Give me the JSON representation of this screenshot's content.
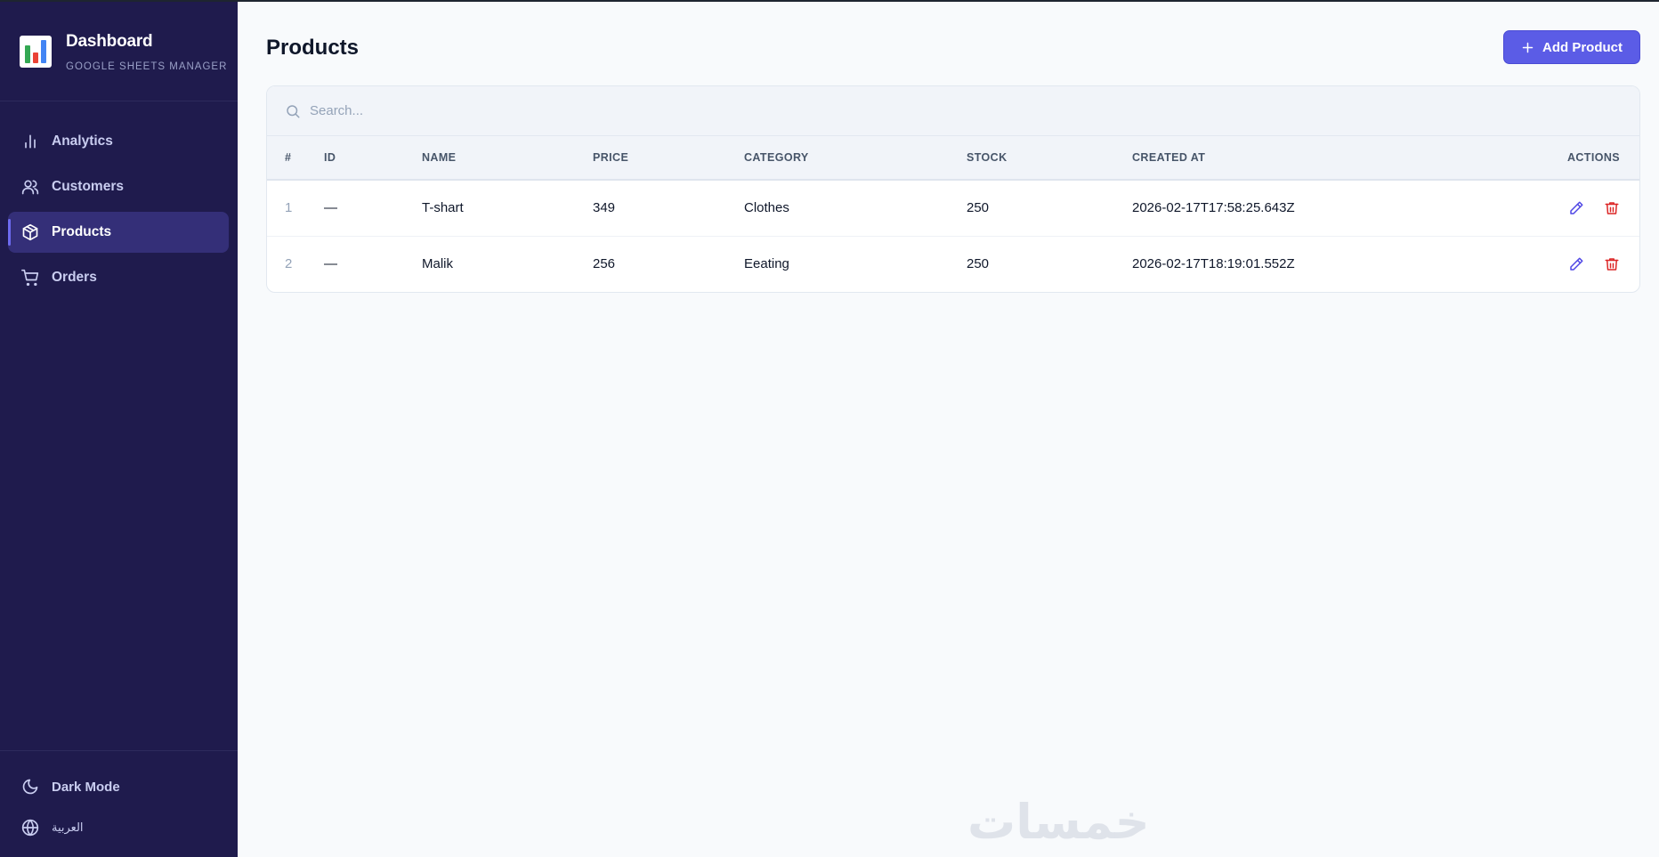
{
  "brand": {
    "title": "Dashboard",
    "subtitle": "GOOGLE SHEETS MANAGER"
  },
  "sidebar": {
    "items": [
      {
        "label": "Analytics",
        "icon": "bar-chart-icon",
        "active": false
      },
      {
        "label": "Customers",
        "icon": "users-icon",
        "active": false
      },
      {
        "label": "Products",
        "icon": "package-icon",
        "active": true
      },
      {
        "label": "Orders",
        "icon": "cart-icon",
        "active": false
      }
    ],
    "bottom": {
      "dark_mode": "Dark Mode",
      "language": "العربية"
    }
  },
  "page": {
    "title": "Products",
    "add_button": "Add Product"
  },
  "search": {
    "placeholder": "Search..."
  },
  "table": {
    "headers": [
      "#",
      "ID",
      "NAME",
      "PRICE",
      "CATEGORY",
      "STOCK",
      "CREATED AT",
      "ACTIONS"
    ],
    "rows": [
      {
        "index": "1",
        "id": "—",
        "name": "T-shart",
        "price": "349",
        "category": "Clothes",
        "stock": "250",
        "created_at": "2026-02-17T17:58:25.643Z"
      },
      {
        "index": "2",
        "id": "—",
        "name": "Malik",
        "price": "256",
        "category": "Eeating",
        "stock": "250",
        "created_at": "2026-02-17T18:19:01.552Z"
      }
    ]
  },
  "watermark": "خمسات",
  "colors": {
    "sidebar_bg": "#1f1b4d",
    "active_bg": "#342f78",
    "accent": "#5b5ce6",
    "edit": "#4f46e5",
    "delete": "#dc2626"
  }
}
